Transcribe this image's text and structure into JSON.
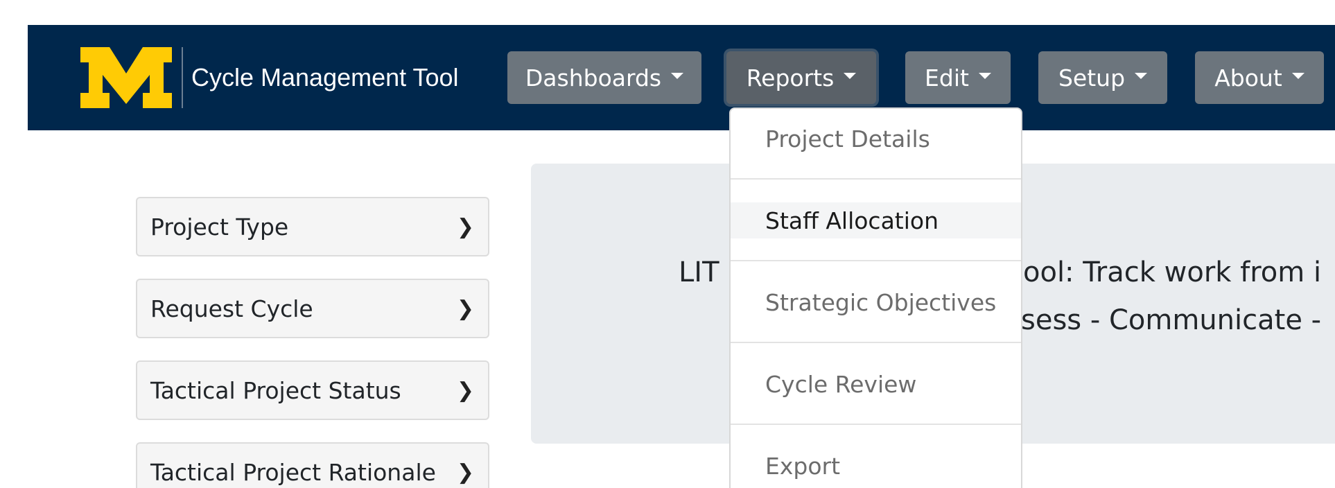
{
  "app": {
    "title": "Cycle Management Tool",
    "logo_letter": "M",
    "colors": {
      "navbar": "#00274c",
      "logo": "#ffcb05",
      "button": "#6c757d"
    }
  },
  "nav": {
    "dashboards": "Dashboards",
    "reports": "Reports",
    "edit": "Edit",
    "setup": "Setup",
    "about": "About"
  },
  "reports_menu": {
    "project_details": "Project Details",
    "staff_allocation": "Staff Allocation",
    "strategic_objectives": "Strategic Objectives",
    "cycle_review": "Cycle Review",
    "export": "Export"
  },
  "sidebar": {
    "items": [
      {
        "label": "Project Type"
      },
      {
        "label": "Request Cycle"
      },
      {
        "label": "Tactical Project Status"
      },
      {
        "label": "Tactical Project Rationale"
      }
    ],
    "chevron": "❯"
  },
  "jumbotron": {
    "line1_start": "LIT",
    "line1_end": "ool: Track work from i",
    "line2_end": "sess - Communicate -"
  }
}
